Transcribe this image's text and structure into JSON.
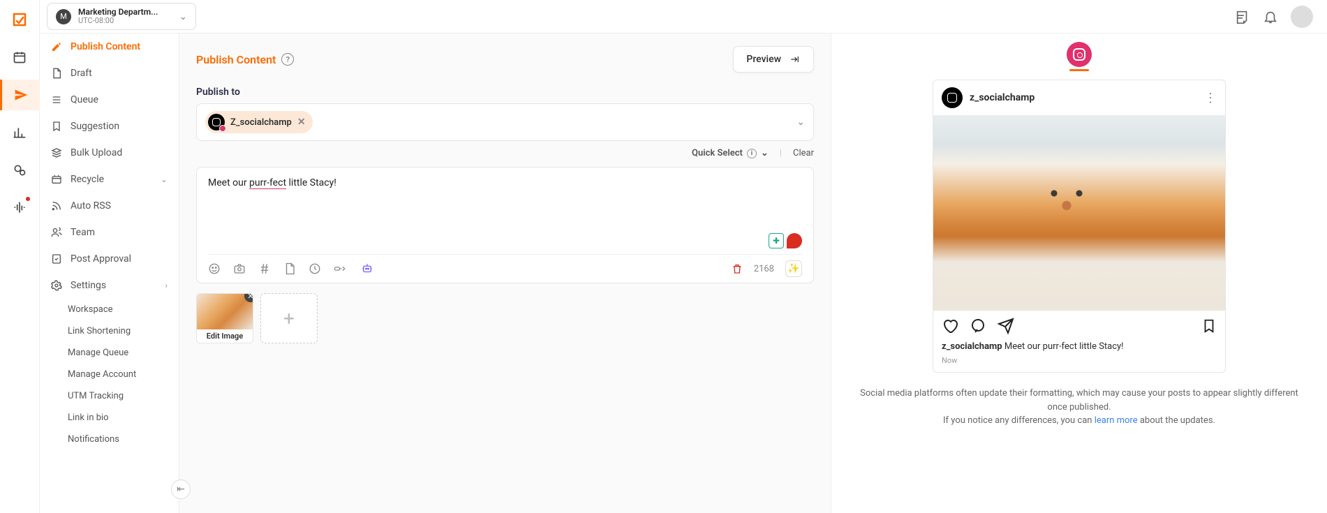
{
  "workspace": {
    "initial": "M",
    "name": "Marketing Departm...",
    "timezone": "UTC-08:00"
  },
  "rail": {
    "items": [
      "calendar",
      "publish",
      "analytics",
      "engage",
      "listen"
    ]
  },
  "sidebar": {
    "items": [
      {
        "icon": "pencil",
        "label": "Publish Content",
        "active": true
      },
      {
        "icon": "file",
        "label": "Draft"
      },
      {
        "icon": "list",
        "label": "Queue"
      },
      {
        "icon": "bookmark",
        "label": "Suggestion"
      },
      {
        "icon": "layers",
        "label": "Bulk Upload"
      },
      {
        "icon": "recycle",
        "label": "Recycle",
        "expandable": true
      },
      {
        "icon": "rss",
        "label": "Auto RSS"
      },
      {
        "icon": "team",
        "label": "Team"
      },
      {
        "icon": "approval",
        "label": "Post Approval"
      },
      {
        "icon": "settings",
        "label": "Settings",
        "expandable": true,
        "expanded": true
      }
    ],
    "settings_sub": [
      "Workspace",
      "Link Shortening",
      "Manage Queue",
      "Manage Account",
      "UTM Tracking",
      "Link in bio",
      "Notifications"
    ]
  },
  "composer": {
    "title": "Publish Content",
    "preview_btn": "Preview",
    "publish_to_label": "Publish to",
    "account": "Z_socialchamp",
    "quick_select": "Quick Select",
    "clear": "Clear",
    "caption_pre": "Meet our ",
    "caption_err": "purr-fect",
    "caption_post": " little Stacy!",
    "char_count": "2168",
    "edit_image": "Edit Image"
  },
  "preview": {
    "username": "z_socialchamp",
    "caption_user": "z_socialchamp",
    "caption_text": "Meet our purr-fect little Stacy!",
    "time": "Now",
    "disclaimer1": "Social media platforms often update their formatting, which may cause your posts to appear slightly different once published.",
    "disclaimer2a": "If you notice any differences, you can ",
    "disclaimer2_link": "learn more",
    "disclaimer2b": " about the updates."
  }
}
